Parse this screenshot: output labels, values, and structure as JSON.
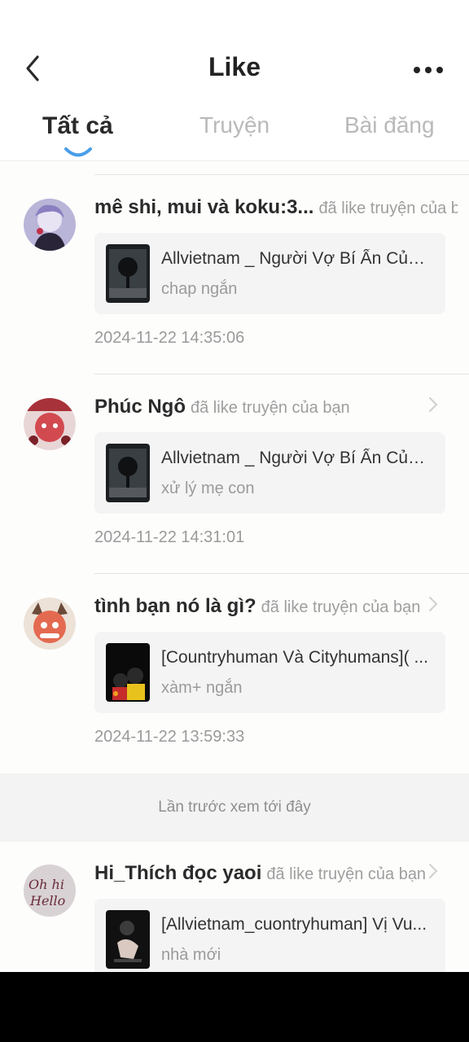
{
  "header": {
    "title": "Like",
    "tabs": [
      {
        "label": "Tất cả",
        "active": true
      },
      {
        "label": "Truyện",
        "active": false
      },
      {
        "label": "Bài đăng",
        "active": false
      }
    ]
  },
  "items": [
    {
      "username": "mê shi, mui và koku:3...",
      "action": "đã like truyện của bạn",
      "story_title": "Allvietnam _ Người Vợ Bí Ẩn Của ...",
      "chapter": "chap ngắn",
      "timestamp": "2024-11-22 14:35:06"
    },
    {
      "username": "Phúc Ngô",
      "action": "đã like truyện của bạn",
      "story_title": "Allvietnam _ Người Vợ Bí Ẩn Của ...",
      "chapter": "xử lý mẹ con",
      "timestamp": "2024-11-22 14:31:01"
    },
    {
      "username": "tình bạn nó là gì?",
      "action": "đã like truyện của bạn",
      "story_title": "[Countryhuman Và Cityhumans]( ...",
      "chapter": "xàm+ ngắn",
      "timestamp": "2024-11-22 13:59:33"
    },
    {
      "username": "Hi_Thích đọc yaoi",
      "action": "đã like truyện của bạn",
      "story_title": "[Allvietnam_cuontryhuman] Vị Vu...",
      "chapter": "nhà mới",
      "timestamp": ""
    }
  ],
  "divider_text": "Lần trước xem tới đây",
  "colors": {
    "accent": "#4a9eea",
    "text_primary": "#2b2b2b",
    "text_secondary": "#9a9a9a",
    "card_bg": "#f4f4f4"
  },
  "icons": {
    "back": "chevron-left-icon",
    "more": "more-horizontal-icon",
    "row": "chevron-right-icon"
  }
}
